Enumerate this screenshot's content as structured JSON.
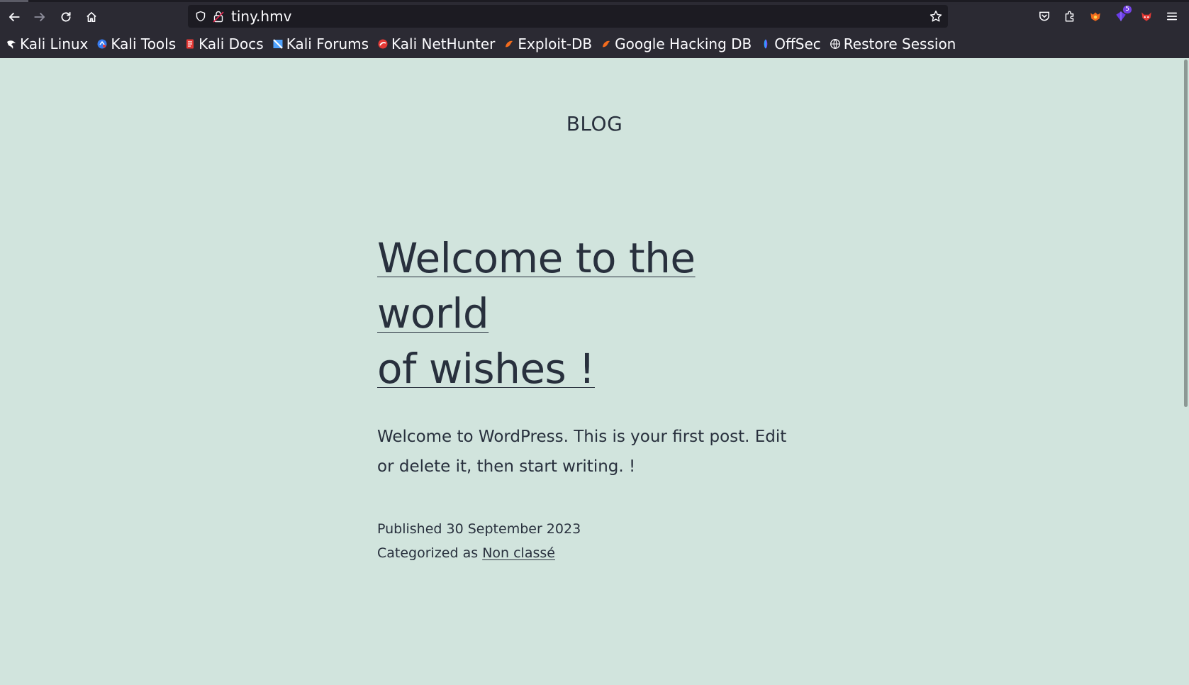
{
  "browser": {
    "url": "tiny.hmv",
    "extension_badge": "5",
    "bookmarks": [
      {
        "label": "Kali Linux",
        "icon": "kali-dragon-icon",
        "color": "#ffffff"
      },
      {
        "label": "Kali Tools",
        "icon": "kali-tools-icon",
        "color": "#367bf0"
      },
      {
        "label": "Kali Docs",
        "icon": "kali-docs-icon",
        "color": "#e53935"
      },
      {
        "label": "Kali Forums",
        "icon": "kali-forums-icon",
        "color": "#4fa3ff"
      },
      {
        "label": "Kali NetHunter",
        "icon": "nethunter-icon",
        "color": "#e53935"
      },
      {
        "label": "Exploit-DB",
        "icon": "exploit-db-icon",
        "color": "#f26b1d"
      },
      {
        "label": "Google Hacking DB",
        "icon": "ghdb-icon",
        "color": "#f26b1d"
      },
      {
        "label": "OffSec",
        "icon": "offsec-icon",
        "color": "#6a5cff"
      },
      {
        "label": "Restore Session",
        "icon": "globe-icon",
        "color": "#fbfbfe"
      }
    ]
  },
  "page": {
    "site_title": "BLOG",
    "post": {
      "title_line1": "Welcome to the world",
      "title_line2": "of wishes !",
      "body": "Welcome to WordPress. This is your first post. Edit or delete it, then start writing. !",
      "published_label": "Published",
      "published_date": "30 September 2023",
      "category_label": "Categorized as",
      "category": "Non classé"
    }
  },
  "colors": {
    "background": "#d1e4dd",
    "text": "#28303d",
    "chrome": "#2b2a33",
    "urlbar": "#1c1b22"
  }
}
